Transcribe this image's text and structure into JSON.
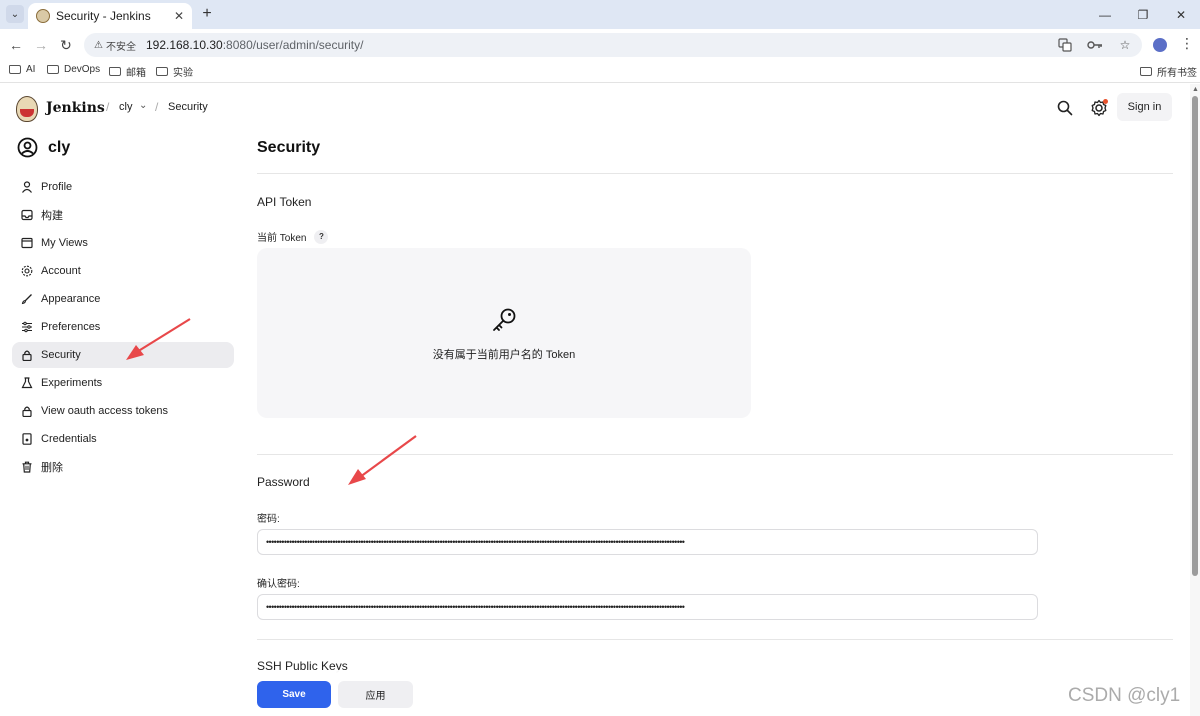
{
  "browser": {
    "tab_title": "Security - Jenkins",
    "insecure_label": "不安全",
    "url_host": "192.168.10.30",
    "url_rest": ":8080/user/admin/security/",
    "bookmarks": [
      "AI",
      "DevOps",
      "邮箱",
      "实验"
    ],
    "all_bookmarks": "所有书签"
  },
  "header": {
    "brand": "Jenkins",
    "breadcrumb_user": "cly",
    "breadcrumb_page": "Security",
    "sign_in": "Sign in"
  },
  "sidebar": {
    "user": "cly",
    "items": [
      {
        "label": "Profile",
        "icon": "person-icon"
      },
      {
        "label": "构建",
        "icon": "inbox-icon"
      },
      {
        "label": "My Views",
        "icon": "window-icon"
      },
      {
        "label": "Account",
        "icon": "gear-icon"
      },
      {
        "label": "Appearance",
        "icon": "brush-icon"
      },
      {
        "label": "Preferences",
        "icon": "sliders-icon"
      },
      {
        "label": "Security",
        "icon": "lock-icon"
      },
      {
        "label": "Experiments",
        "icon": "flask-icon"
      },
      {
        "label": "View oauth access tokens",
        "icon": "lock-icon"
      },
      {
        "label": "Credentials",
        "icon": "id-card-icon"
      },
      {
        "label": "删除",
        "icon": "trash-icon"
      }
    ],
    "active_index": 6
  },
  "main": {
    "title": "Security",
    "api_token": {
      "section": "API Token",
      "current_label": "当前 Token",
      "help": "?",
      "empty_message": "没有属于当前用户名的 Token"
    },
    "password": {
      "section": "Password",
      "label": "密码:",
      "confirm_label": "确认密码:",
      "value_mask": "••••••••••••••••••••••••••••••••••••••••••••••••••••••••••••••••••••••••••••••••••••••••••••••••••••••••••••••••••••••••••••••••••••••••••••••••••••••••••••••••••••"
    },
    "ssh_section": "SSH Public Keys",
    "save": "Save",
    "apply": "应用"
  },
  "watermark": "CSDN @cly1",
  "colors": {
    "primary": "#2f63ec",
    "annotation_arrow": "#e8484a"
  }
}
